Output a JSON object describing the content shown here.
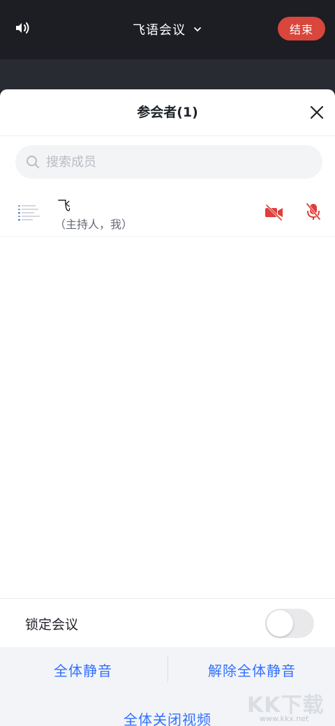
{
  "topbar": {
    "title": "飞语会议",
    "end_label": "结束"
  },
  "sheet": {
    "title": "参会者(1)",
    "search": {
      "placeholder": "搜索成员",
      "value": ""
    },
    "participants": [
      {
        "name": "飞",
        "role": "（主持人，我）"
      }
    ],
    "lock": {
      "label": "锁定会议",
      "enabled": false
    },
    "actions": {
      "mute_all": "全体静音",
      "unmute_all": "解除全体静音",
      "video_off_all": "全体关闭视频"
    }
  },
  "watermark": {
    "brand": "KK下载",
    "site": "www.kkx.net"
  },
  "colors": {
    "accent": "#3370ff",
    "danger": "#d8463c",
    "topbar": "#1c1e24"
  }
}
